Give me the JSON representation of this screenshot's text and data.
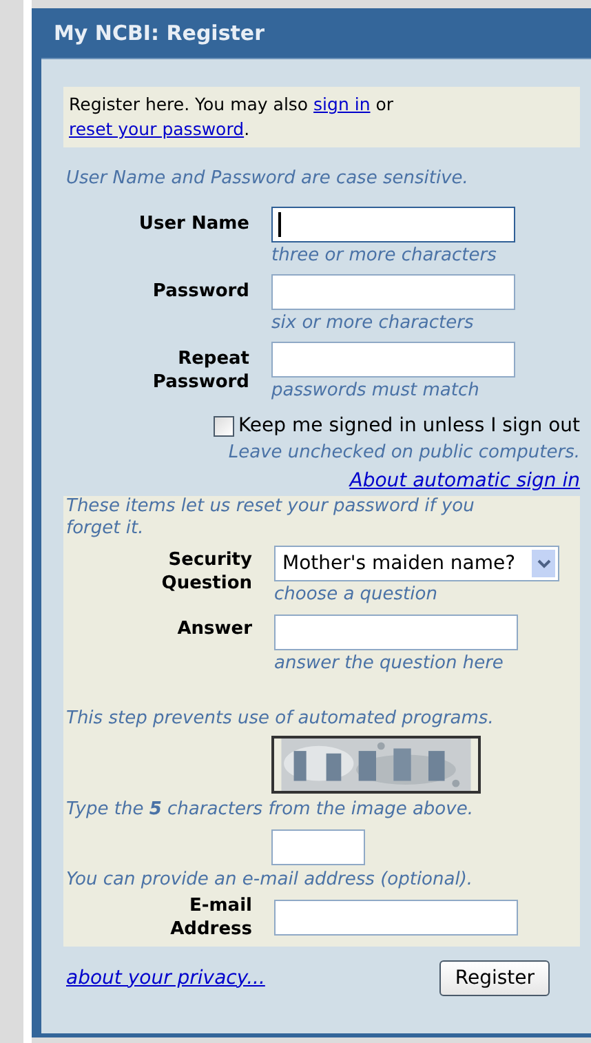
{
  "header": {
    "title": "My NCBI: Register"
  },
  "intro": {
    "text": "Register here. You may also ",
    "link_1": "sign in",
    "joiner": " or ",
    "link_2": "reset your password",
    "end": "."
  },
  "note": "User Name and Password are case sensitive.",
  "fields": [
    {
      "label": "User Name",
      "hint": "three or more characters",
      "focused": true
    },
    {
      "label": "Password",
      "hint": "six or more characters",
      "focused": false
    },
    {
      "label": "Repeat Password",
      "hint": "passwords must match",
      "focused": false
    }
  ],
  "keep_signed_in": {
    "label": "Keep me signed in unless I sign out",
    "checked": false,
    "hint": "Leave unchecked on public computers.",
    "link": "About automatic sign in"
  },
  "recovery": {
    "note": "These items let us reset your password if you forget it.",
    "question_label": "Security Question",
    "question_value": "Mother's maiden name?",
    "question_hint": "choose a question",
    "answer_label": "Answer",
    "answer_hint": "answer the question here"
  },
  "captcha": {
    "note": "This step prevents use of automated programs.",
    "instruction": "Type the **5** characters from the image above."
  },
  "email": {
    "note": "You can provide an e-mail address (optional).",
    "label": "E-mail Address"
  },
  "footer": {
    "privacy_link": "about your privacy...",
    "button": "Register"
  }
}
